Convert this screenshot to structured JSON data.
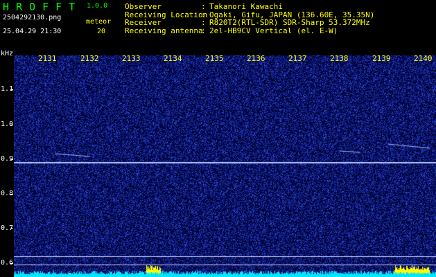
{
  "app": {
    "name": "HROFFT",
    "version": "1.0.0"
  },
  "file_name": "2504292130.png",
  "datetime": "25.04.29 21:30",
  "meteor_label": "meteor",
  "meteor_count": "20",
  "info": [
    {
      "key": "Observer",
      "value": "Takanori Kawachi"
    },
    {
      "key": "Receiving Location",
      "value": "Ogaki, Gifu, JAPAN (136.60E, 35.35N)"
    },
    {
      "key": "Receiver",
      "value": "R820T2(RTL-SDR) SDR-Sharp 53.372MHz"
    },
    {
      "key": "Receiving antenna",
      "value": "2el-HB9CV Vertical (el. E-W)"
    }
  ],
  "axis": {
    "unit": "kHz",
    "minutes": [
      "2131",
      "2132",
      "2133",
      "2134",
      "2135",
      "2136",
      "2137",
      "2138",
      "2139",
      "2140"
    ],
    "freq_labels": [
      "1.1",
      "1.0",
      "0.9",
      "0.8",
      "0.7",
      "0.6"
    ]
  },
  "colors": {
    "background": "#00003a",
    "noise_blue": "#1b3cff",
    "carrier": "#b0c8ff",
    "activity": "#00e5ff",
    "peak": "#ffff00"
  }
}
